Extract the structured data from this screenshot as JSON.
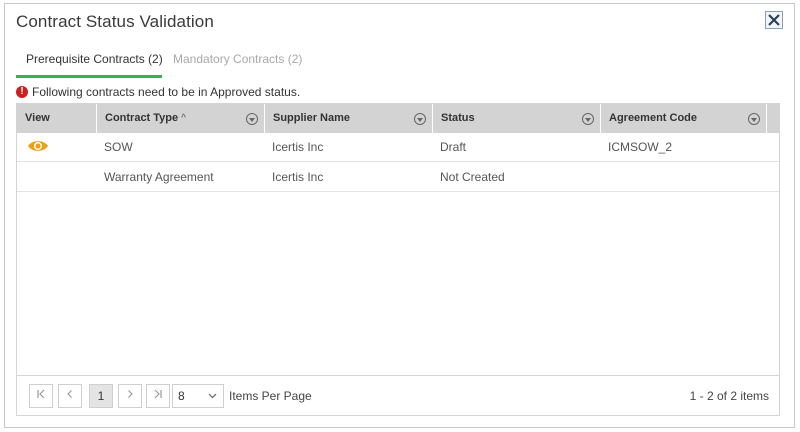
{
  "dialog": {
    "title": "Contract Status Validation"
  },
  "tabs": [
    {
      "label": "Prerequisite Contracts (2)",
      "active": true
    },
    {
      "label": "Mandatory Contracts (2)",
      "active": false
    }
  ],
  "warning": {
    "icon": "error-icon",
    "text": "Following contracts need to be in Approved status."
  },
  "grid": {
    "columns": [
      {
        "label": "View",
        "filterable": false
      },
      {
        "label": "Contract Type",
        "sorted": "ascending",
        "sort_glyph": "^",
        "filterable": true
      },
      {
        "label": "Supplier Name",
        "filterable": true
      },
      {
        "label": "Status",
        "filterable": true
      },
      {
        "label": "Agreement Code",
        "filterable": true
      }
    ],
    "rows": [
      {
        "view_icon": "eye-icon",
        "contract_type": "SOW",
        "supplier_name": "Icertis Inc",
        "status": "Draft",
        "agreement_code": "ICMSOW_2"
      },
      {
        "view_icon": "",
        "contract_type": "Warranty Agreement",
        "supplier_name": "Icertis Inc",
        "status": "Not Created",
        "agreement_code": ""
      }
    ]
  },
  "pager": {
    "first_glyph": "K",
    "prev_glyph": "<",
    "current_page": "1",
    "next_glyph": ">",
    "last_glyph": "⨯",
    "page_size": "8",
    "items_per_page_label": "Items Per Page",
    "range_text": "1 - 2 of 2 items"
  },
  "colors": {
    "active_tab_underline": "#3cb04b",
    "warning": "#cc1f1f",
    "eye_icon": "#e8a21a",
    "header_bg": "#d3d3d3"
  }
}
